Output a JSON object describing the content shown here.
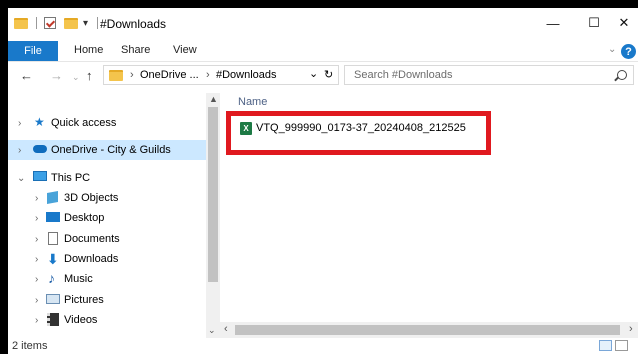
{
  "window": {
    "title": "#Downloads",
    "controls": {
      "minimize": "—",
      "maximize": "☐",
      "close": "✕"
    }
  },
  "ribbon": {
    "file": "File",
    "tabs": [
      "Home",
      "Share",
      "View"
    ],
    "help": "?"
  },
  "address": {
    "back": "←",
    "forward": "→",
    "up": "↑",
    "crumbs": [
      "OneDrive ...",
      "#Downloads"
    ],
    "separator": "›",
    "dropdown": "⌄",
    "refresh": "↻"
  },
  "search": {
    "placeholder": "Search #Downloads"
  },
  "nav": {
    "items": [
      {
        "label": "Quick access",
        "icon": "star-icon",
        "selected": false
      },
      {
        "label": "OneDrive - City & Guilds",
        "icon": "cloud-icon",
        "selected": true
      },
      {
        "label": "This PC",
        "icon": "monitor-icon",
        "selected": false
      },
      {
        "label": "3D Objects",
        "icon": "cube-icon",
        "selected": false
      },
      {
        "label": "Desktop",
        "icon": "desktop-icon",
        "selected": false
      },
      {
        "label": "Documents",
        "icon": "document-icon",
        "selected": false
      },
      {
        "label": "Downloads",
        "icon": "download-icon",
        "selected": false
      },
      {
        "label": "Music",
        "icon": "music-icon",
        "selected": false
      },
      {
        "label": "Pictures",
        "icon": "picture-icon",
        "selected": false
      },
      {
        "label": "Videos",
        "icon": "video-icon",
        "selected": false
      }
    ]
  },
  "content": {
    "column_header": "Name",
    "files": [
      {
        "name": "VTQ_999990_0173-37_20240408_212525",
        "icon": "excel-icon",
        "icon_text": "X"
      }
    ]
  },
  "status": {
    "count": "2 items"
  },
  "colors": {
    "accent": "#1979ca",
    "selected_bg": "#cce8ff",
    "highlight_box": "#e0191f",
    "excel_green": "#1d7a45"
  }
}
